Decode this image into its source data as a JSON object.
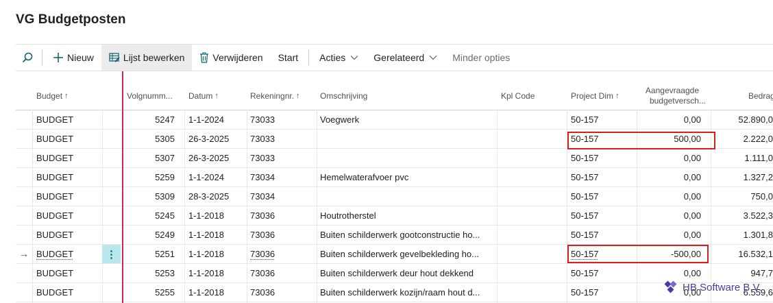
{
  "page": {
    "title": "VG Budgetposten"
  },
  "toolbar": {
    "new_label": "Nieuw",
    "edit_list_label": "Lijst bewerken",
    "delete_label": "Verwijderen",
    "start_label": "Start",
    "actions_label": "Acties",
    "related_label": "Gerelateerd",
    "fewer_options_label": "Minder opties"
  },
  "columns": {
    "budget": "Budget",
    "volgnummer": "Volgnumm...",
    "datum": "Datum",
    "rekeningnr": "Rekeningnr.",
    "omschrijving": "Omschrijving",
    "kpl_code": "Kpl Code",
    "project_dim": "Project Dim",
    "aangevraagde_line1": "Aangevraagde",
    "aangevraagde_line2": "budgetversch...",
    "bedrag": "Bedrag"
  },
  "rows": [
    {
      "budget": "BUDGET",
      "volgnummer": "5247",
      "datum": "1-1-2024",
      "rekeningnr": "73033",
      "omschrijving": "Voegwerk",
      "project_dim": "50-157",
      "aangevraagd": "0,00",
      "bedrag": "52.890,0"
    },
    {
      "budget": "BUDGET",
      "volgnummer": "5305",
      "datum": "26-3-2025",
      "rekeningnr": "73033",
      "omschrijving": "",
      "project_dim": "50-157",
      "aangevraagd": "500,00",
      "bedrag": "2.222,0"
    },
    {
      "budget": "BUDGET",
      "volgnummer": "5307",
      "datum": "26-3-2025",
      "rekeningnr": "73033",
      "omschrijving": "",
      "project_dim": "50-157",
      "aangevraagd": "0,00",
      "bedrag": "1.111,0"
    },
    {
      "budget": "BUDGET",
      "volgnummer": "5259",
      "datum": "1-1-2024",
      "rekeningnr": "73034",
      "omschrijving": "Hemelwaterafvoer pvc",
      "project_dim": "50-157",
      "aangevraagd": "0,00",
      "bedrag": "1.327,2"
    },
    {
      "budget": "BUDGET",
      "volgnummer": "5309",
      "datum": "28-3-2025",
      "rekeningnr": "73034",
      "omschrijving": "",
      "project_dim": "50-157",
      "aangevraagd": "0,00",
      "bedrag": "750,0"
    },
    {
      "budget": "BUDGET",
      "volgnummer": "5245",
      "datum": "1-1-2018",
      "rekeningnr": "73036",
      "omschrijving": "Houtrotherstel",
      "project_dim": "50-157",
      "aangevraagd": "0,00",
      "bedrag": "3.522,3"
    },
    {
      "budget": "BUDGET",
      "volgnummer": "5249",
      "datum": "1-1-2018",
      "rekeningnr": "73036",
      "omschrijving": "Buiten schilderwerk gootconstructie ho...",
      "project_dim": "50-157",
      "aangevraagd": "0,00",
      "bedrag": "1.301,8"
    },
    {
      "budget": "BUDGET",
      "volgnummer": "5251",
      "datum": "1-1-2018",
      "rekeningnr": "73036",
      "omschrijving": "Buiten schilderwerk gevelbekleding ho...",
      "project_dim": "50-157",
      "aangevraagd": "-500,00",
      "bedrag": "16.532,1"
    },
    {
      "budget": "BUDGET",
      "volgnummer": "5253",
      "datum": "1-1-2018",
      "rekeningnr": "73036",
      "omschrijving": "Buiten schilderwerk deur hout dekkend",
      "project_dim": "50-157",
      "aangevraagd": "0,00",
      "bedrag": "947,7"
    },
    {
      "budget": "BUDGET",
      "volgnummer": "5255",
      "datum": "1-1-2018",
      "rekeningnr": "73036",
      "omschrijving": "Buiten schilderwerk kozijn/raam hout d...",
      "project_dim": "50-157",
      "aangevraagd": "0,00",
      "bedrag": "6.559,6"
    }
  ],
  "selected_row_indicator": "→",
  "row_menu_glyph": "⋮",
  "watermark": {
    "text": "HB Software B.V."
  },
  "colors": {
    "accent": "#00616a",
    "highlight": "#d91e1e",
    "divider": "#d0245a",
    "watermark": "#4b3a9e"
  }
}
